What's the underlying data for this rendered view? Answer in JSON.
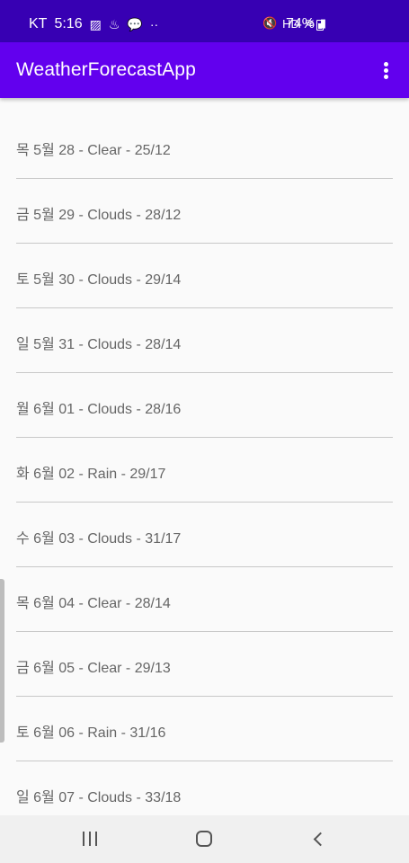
{
  "status_bar": {
    "carrier": "KT",
    "time": "5:16",
    "left_icons": [
      "image-icon",
      "fan-notification-icon",
      "chat-icon",
      "more-dots-icon"
    ],
    "right_icons": [
      "mute-icon",
      "hd-icon",
      "wifi-icon",
      "signal-icon"
    ],
    "battery_percent": "74%",
    "background_color": "#3700b3"
  },
  "app_bar": {
    "title": "WeatherForecastApp",
    "menu_icon": "overflow-menu-icon",
    "background_color": "#6200ee"
  },
  "forecast": {
    "items": [
      {
        "label": "목 5월 28 - Clear - 25/12"
      },
      {
        "label": "금 5월 29 - Clouds - 28/12"
      },
      {
        "label": "토 5월 30 - Clouds - 29/14"
      },
      {
        "label": "일 5월 31 - Clouds - 28/14"
      },
      {
        "label": "월 6월 01 - Clouds - 28/16"
      },
      {
        "label": "화 6월 02 - Rain - 29/17"
      },
      {
        "label": "수 6월 03 - Clouds - 31/17"
      },
      {
        "label": "목 6월 04 - Clear - 28/14"
      },
      {
        "label": "금 6월 05 - Clear - 29/13"
      },
      {
        "label": "토 6월 06 - Rain - 31/16"
      },
      {
        "label": "일 6월 07 - Clouds - 33/18"
      }
    ]
  },
  "nav_bar": {
    "buttons": [
      "recent-apps-icon",
      "home-icon",
      "back-icon"
    ]
  }
}
